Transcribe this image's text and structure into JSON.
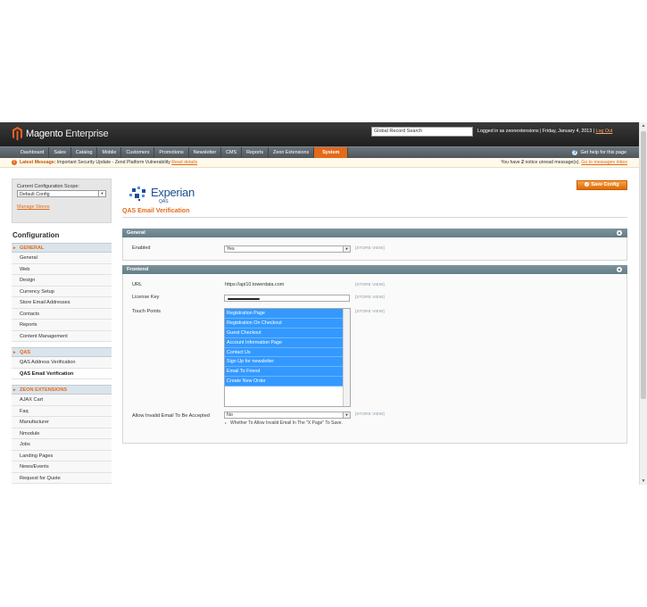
{
  "header": {
    "brand": "Magento",
    "brand_suffix": "Enterprise",
    "search_value": "Global Record Search",
    "user_text": "Logged in as zeonextensions | Friday, January 4, 2013 |",
    "logout": "Log Out"
  },
  "nav": {
    "items": [
      "Dashboard",
      "Sales",
      "Catalog",
      "Mobile",
      "Customers",
      "Promotions",
      "Newsletter",
      "CMS",
      "Reports",
      "Zeon Extensions",
      "System"
    ],
    "active": "System",
    "help": "Get help for this page"
  },
  "notice": {
    "label": "Latest Message:",
    "text": "Important Security Update - Zend Platform Vulnerability",
    "link": "Read details",
    "right_text_a": "You have",
    "right_count": "2",
    "right_text_b": "notice unread message(s).",
    "right_link": "Go to messages inbox"
  },
  "sidebar": {
    "scope_label": "Current Configuration Scope:",
    "scope_value": "Default Config",
    "manage_stores": "Manage Stores",
    "title": "Configuration",
    "groups": [
      {
        "title": "GENERAL",
        "items": [
          "General",
          "Web",
          "Design",
          "Currency Setup",
          "Store Email Addresses",
          "Contacts",
          "Reports",
          "Content Management"
        ]
      },
      {
        "title": "QAS",
        "items": [
          "QAS Address Verification",
          "QAS Email Verification"
        ]
      },
      {
        "title": "ZEON EXTENSIONS",
        "items": [
          "AJAX Cart",
          "Faq",
          "Manufacturer",
          "Nmodule",
          "Jobs",
          "Landing Pages",
          "News/Events",
          "Request for Quote"
        ]
      }
    ]
  },
  "main": {
    "logo_word": "Experian",
    "logo_sub": "QAS",
    "page_title": "QAS Email Verification",
    "save_label": "Save Config",
    "general": {
      "title": "General",
      "enabled_label": "Enabled",
      "enabled_value": "Yes",
      "scope": "[STORE VIEW]"
    },
    "frontend": {
      "title": "Frontend",
      "url_label": "URL",
      "url_value": "https://api10.towerdata.com",
      "license_label": "License Key",
      "touch_label": "Touch Points",
      "touch_options": [
        "Registration Page",
        "Registration On Checkout",
        "Guest Checkout",
        "Account Information Page",
        "Contact Us",
        "Sign Up for newsletter",
        "Email To Friend",
        "Create New Order"
      ],
      "invalid_label": "Allow Invalid Email To Be Accepted",
      "invalid_value": "No",
      "invalid_note": "Whether To Allow Invalid Email In The \"X Page\" To Save.",
      "scope": "[STORE VIEW]"
    }
  },
  "colors": {
    "accent": "#e36a1a",
    "header": "#2a2a2a",
    "section": "#6f8992",
    "selected": "#3399ff",
    "brand_blue": "#1d4f91"
  }
}
